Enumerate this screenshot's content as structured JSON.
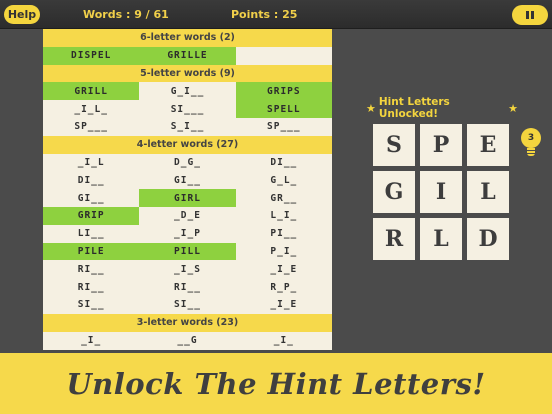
{
  "topbar": {
    "help_label": "Help",
    "words_text": "Words : 9 / 61",
    "points_text": "Points : 25",
    "pause_icon": "pause-icon"
  },
  "table": {
    "sections": [
      {
        "title": "6-letter words (2)",
        "rows": [
          [
            {
              "text": "DISPEL",
              "found": true
            },
            {
              "text": "GRILLE",
              "found": true
            },
            {
              "text": "",
              "found": false
            }
          ]
        ]
      },
      {
        "title": "5-letter words (9)",
        "rows": [
          [
            {
              "text": "GRILL",
              "found": true
            },
            {
              "text": "G_I__",
              "found": false
            },
            {
              "text": "GRIPS",
              "found": true
            }
          ],
          [
            {
              "text": "_I_L_",
              "found": false
            },
            {
              "text": "SI___",
              "found": false
            },
            {
              "text": "SPELL",
              "found": true
            }
          ],
          [
            {
              "text": "SP___",
              "found": false
            },
            {
              "text": "S_I__",
              "found": false
            },
            {
              "text": "SP___",
              "found": false
            }
          ]
        ]
      },
      {
        "title": "4-letter words (27)",
        "rows": [
          [
            {
              "text": "_I_L",
              "found": false
            },
            {
              "text": "D_G_",
              "found": false
            },
            {
              "text": "DI__",
              "found": false
            }
          ],
          [
            {
              "text": "DI__",
              "found": false
            },
            {
              "text": "GI__",
              "found": false
            },
            {
              "text": "G_L_",
              "found": false
            }
          ],
          [
            {
              "text": "GI__",
              "found": false
            },
            {
              "text": "GIRL",
              "found": true
            },
            {
              "text": "GR__",
              "found": false
            }
          ],
          [
            {
              "text": "GRIP",
              "found": true
            },
            {
              "text": "_D_E",
              "found": false
            },
            {
              "text": "L_I_",
              "found": false
            }
          ],
          [
            {
              "text": "LI__",
              "found": false
            },
            {
              "text": "_I_P",
              "found": false
            },
            {
              "text": "PI__",
              "found": false
            }
          ],
          [
            {
              "text": "PILE",
              "found": true
            },
            {
              "text": "PILL",
              "found": true
            },
            {
              "text": "P_I_",
              "found": false
            }
          ],
          [
            {
              "text": "RI__",
              "found": false
            },
            {
              "text": "_I_S",
              "found": false
            },
            {
              "text": "_I_E",
              "found": false
            }
          ],
          [
            {
              "text": "RI__",
              "found": false
            },
            {
              "text": "RI__",
              "found": false
            },
            {
              "text": "R_P_",
              "found": false
            }
          ],
          [
            {
              "text": "SI__",
              "found": false
            },
            {
              "text": "SI__",
              "found": false
            },
            {
              "text": "_I_E",
              "found": false
            }
          ]
        ]
      },
      {
        "title": "3-letter words (23)",
        "rows": [
          [
            {
              "text": "_I_",
              "found": false
            },
            {
              "text": "__G",
              "found": false
            },
            {
              "text": "_I_",
              "found": false
            }
          ]
        ]
      }
    ]
  },
  "hint": {
    "title": "Hint Letters Unlocked!",
    "star_icon": "star-icon",
    "letters": [
      "S",
      "P",
      "E",
      "G",
      "I",
      "L",
      "R",
      "L",
      "D"
    ],
    "hints_remaining": "3",
    "bulb_icon": "lightbulb-icon"
  },
  "banner": {
    "text": "Unlock The Hint Letters!"
  },
  "colors": {
    "accent_yellow": "#f6d94b",
    "found_green": "#8ed13f",
    "background": "#4b4b4b",
    "table_bg": "#f5f0e2"
  }
}
